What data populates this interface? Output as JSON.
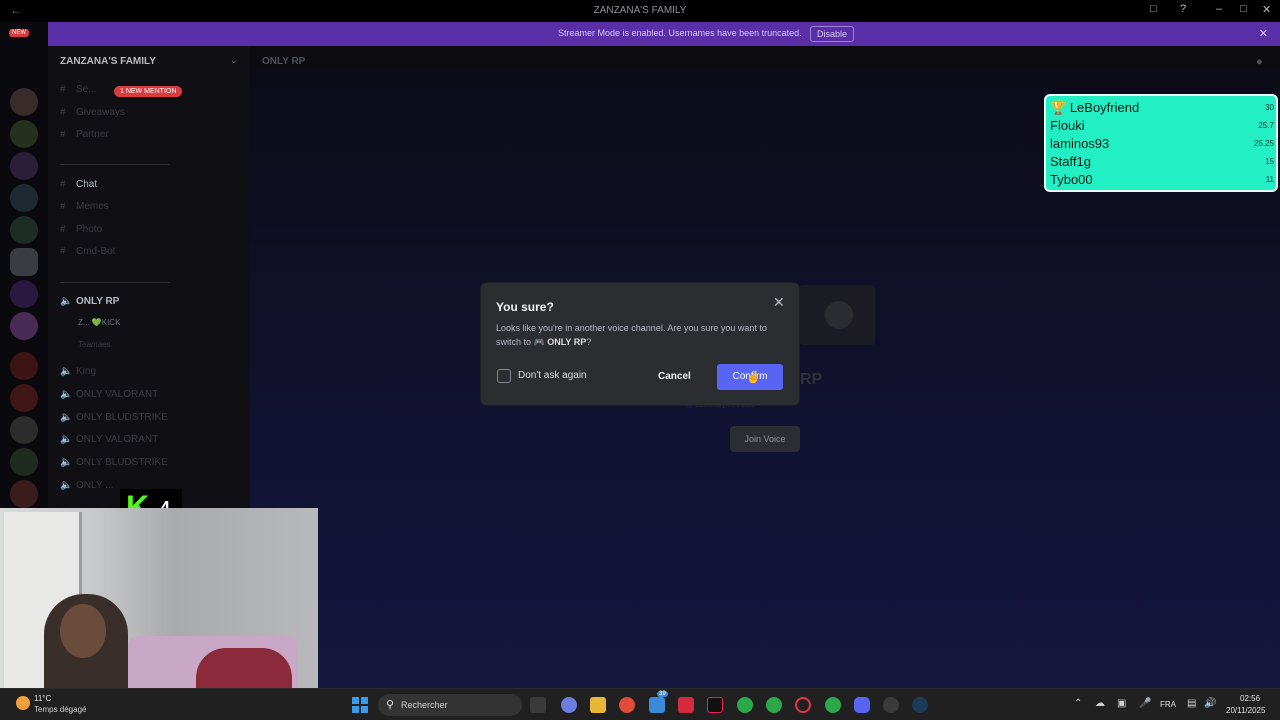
{
  "window": {
    "title": "ZANZANA'S FAMILY"
  },
  "banner": {
    "message": "Streamer Mode is enabled. Usernames have been truncated.",
    "disable_label": "Disable"
  },
  "rail": {
    "new_badge": "NEW"
  },
  "sidebar": {
    "server_name": "ZANZANA'S FAMILY",
    "mention_badge": "1 NEW MENTION",
    "channels": [
      {
        "label": "Se..."
      },
      {
        "label": "Giveaways"
      },
      {
        "label": "Partner"
      },
      {
        "label": "Chat"
      },
      {
        "label": "Memes"
      },
      {
        "label": "Photo"
      },
      {
        "label": "Cmd-Bot"
      },
      {
        "label": "ONLY RP"
      },
      {
        "label": "King"
      },
      {
        "label": "ONLY VALORANT"
      },
      {
        "label": "ONLY BLUDSTRIKE"
      },
      {
        "label": "ONLY VALORANT"
      },
      {
        "label": "ONLY BLUDSTRIKE"
      },
      {
        "label": "ONLY ..."
      }
    ],
    "voice_user": "Z... 💚KICK",
    "voice_user2": "Teamaes"
  },
  "header": {
    "channel": "ONLY RP"
  },
  "voice_area": {
    "title": "RP",
    "subtitle": "... currently in voice",
    "join_label": "Join Voice"
  },
  "leaderboard": [
    {
      "name": "LeBoyfriend",
      "score": "30"
    },
    {
      "name": "Flouki",
      "score": "25.7"
    },
    {
      "name": "laminos93",
      "score": "25.25"
    },
    {
      "name": "Staff1g",
      "score": "15"
    },
    {
      "name": "Tybo00",
      "score": "11"
    }
  ],
  "modal": {
    "title": "You sure?",
    "body_prefix": "Looks like you're in another voice channel. Are you sure you want to switch to",
    "channel": "🎮 ONLY RP",
    "body_suffix": "?",
    "checkbox_label": "Don't ask again",
    "cancel_label": "Cancel",
    "confirm_label": "Confirm"
  },
  "kick_overlay": {
    "count": "4"
  },
  "taskbar": {
    "temperature": "11°C",
    "weather": "Temps dégagé",
    "search_placeholder": "Rechercher",
    "badge_count": "39",
    "language": "FRA",
    "time": "02:56",
    "date": "20/11/2025"
  },
  "colors": {
    "accent": "#5865f2",
    "banner": "#5a2ea6",
    "leaderboard": "#22f0c4",
    "kick": "#53fc18"
  }
}
